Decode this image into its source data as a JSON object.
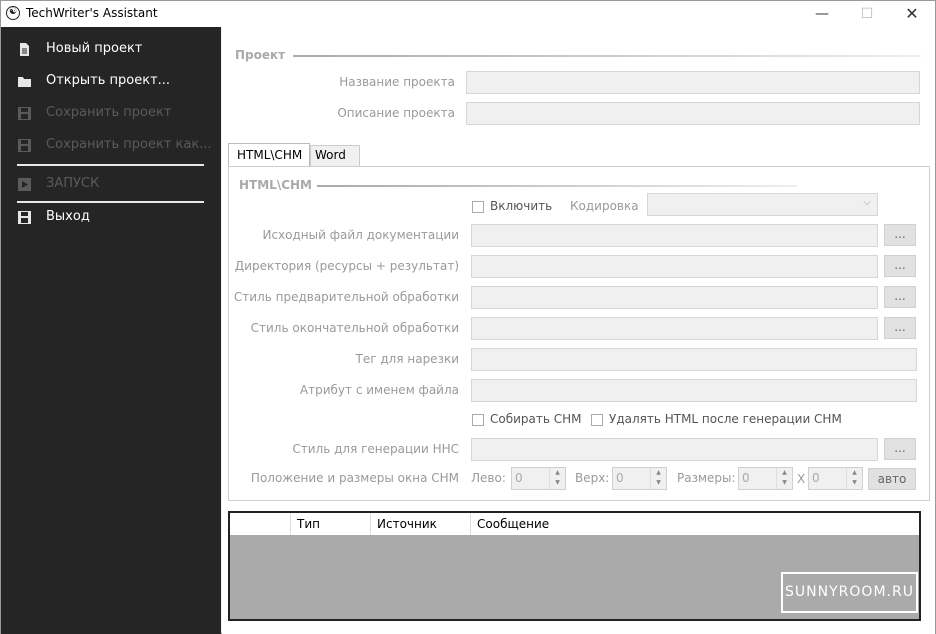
{
  "window": {
    "title": "TechWriter's Assistant",
    "min": "—",
    "max": "☐",
    "close": "✕"
  },
  "sidebar": {
    "items": [
      {
        "label": "Новый проект",
        "icon": "new-file-icon"
      },
      {
        "label": "Открыть проект...",
        "icon": "folder-icon"
      },
      {
        "label": "Сохранить проект",
        "icon": "save-icon"
      },
      {
        "label": "Сохранить проект как...",
        "icon": "save-as-icon"
      },
      {
        "label": "ЗАПУСК",
        "icon": "play-icon"
      },
      {
        "label": "Выход",
        "icon": "exit-icon"
      }
    ]
  },
  "project": {
    "section": "Проект",
    "name_label": "Название проекта",
    "name_value": "",
    "desc_label": "Описание проекта",
    "desc_value": ""
  },
  "tabs": [
    {
      "label": "HTML\\CHM"
    },
    {
      "label": "Word"
    }
  ],
  "html": {
    "section": "HTML\\CHM",
    "enable_label": "Включить",
    "encoding_label": "Кодировка",
    "encoding_value": "",
    "source_label": "Исходный файл документации",
    "dir_label": "Директория (ресурсы + результат)",
    "pre_label": "Стиль предварительной обработки",
    "post_label": "Стиль окончательной обработки",
    "tag_label": "Тег для нарезки",
    "attr_label": "Атрибут с именем файла",
    "build_chm_label": "Собирать CHM",
    "delete_html_label": "Удалять HTML после генерации CHM",
    "hhc_label": "Стиль для генерации HHC",
    "window_label": "Положение и размеры окна CHM",
    "left_label": "Лево:",
    "left_value": "0",
    "top_label": "Верх:",
    "top_value": "0",
    "size_label": "Размеры:",
    "width_value": "0",
    "x_label": "X",
    "height_value": "0",
    "browse": "...",
    "auto": "авто"
  },
  "log": {
    "columns": [
      "",
      "Тип",
      "Источник",
      "Сообщение"
    ]
  },
  "watermark": "SUNNYROOM.RU"
}
